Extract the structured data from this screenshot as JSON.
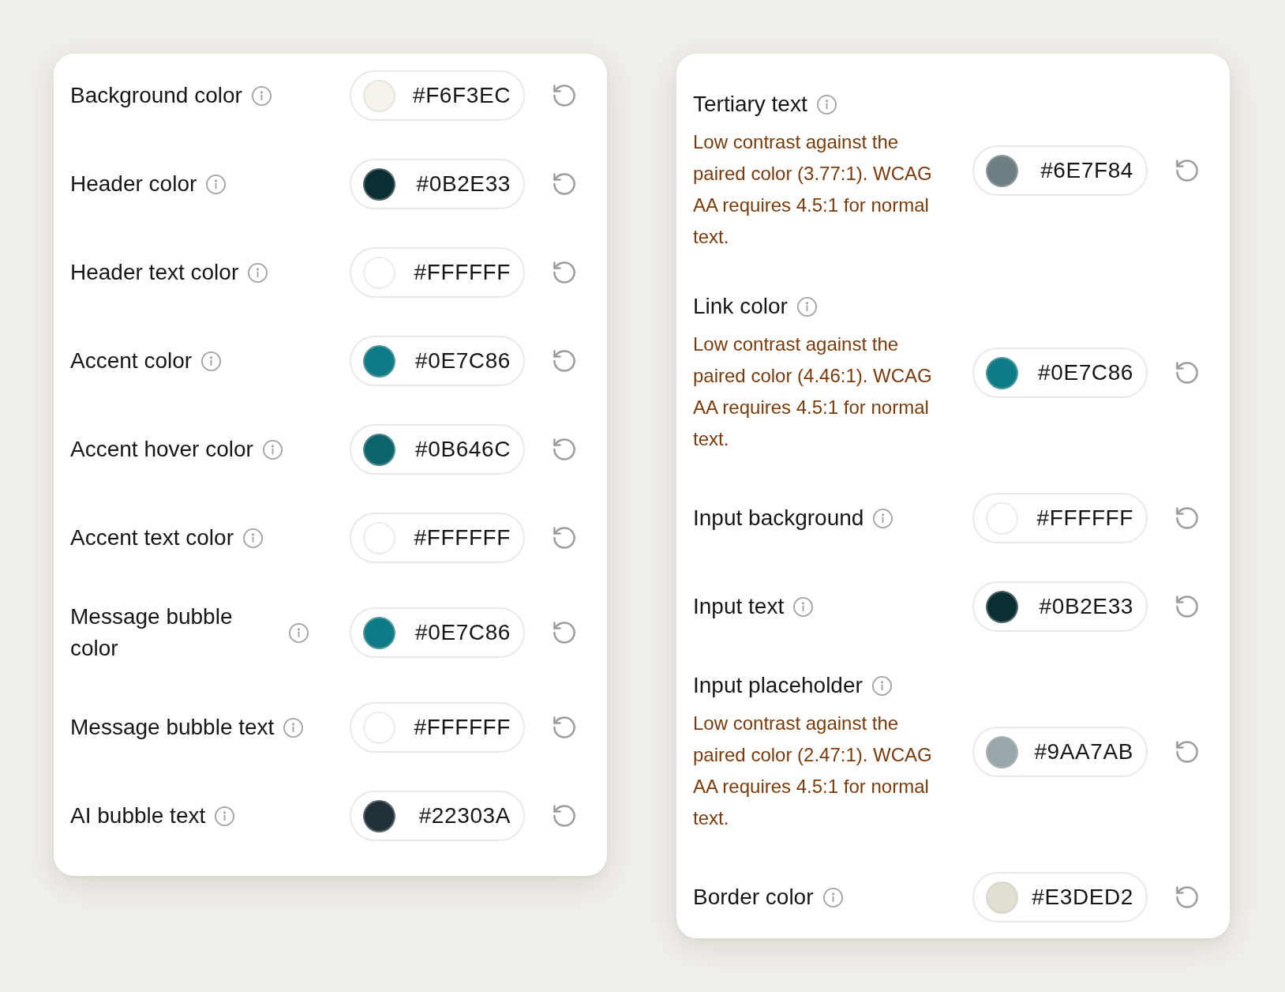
{
  "panels": [
    {
      "settings": [
        {
          "label": "Background color",
          "value": "#F6F3EC",
          "color": "#f6f3ec"
        },
        {
          "label": "Header color",
          "value": "#0B2E33",
          "color": "#0b2e33"
        },
        {
          "label": "Header text color",
          "value": "#FFFFFF",
          "color": "#ffffff"
        },
        {
          "label": "Accent color",
          "value": "#0E7C86",
          "color": "#0e7c86"
        },
        {
          "label": "Accent hover color",
          "value": "#0B646C",
          "color": "#0b646c"
        },
        {
          "label": "Accent text color",
          "value": "#FFFFFF",
          "color": "#ffffff"
        },
        {
          "label": "Message bubble color",
          "value": "#0E7C86",
          "color": "#0e7c86"
        },
        {
          "label": "Message bubble text",
          "value": "#FFFFFF",
          "color": "#ffffff"
        },
        {
          "label": "AI bubble text",
          "value": "#22303A",
          "color": "#22303a"
        }
      ]
    },
    {
      "settings": [
        {
          "label": "Tertiary text",
          "warning": "Low contrast against the paired color (3.77:1). WCAG AA requires 4.5:1 for normal text.",
          "value": "#6E7F84",
          "color": "#6e7f84"
        },
        {
          "label": "Link color",
          "warning": "Low contrast against the paired color (4.46:1). WCAG AA requires 4.5:1 for normal text.",
          "value": "#0E7C86",
          "color": "#0e7c86"
        },
        {
          "label": "Input background",
          "value": "#FFFFFF",
          "color": "#ffffff"
        },
        {
          "label": "Input text",
          "value": "#0B2E33",
          "color": "#0b2e33"
        },
        {
          "label": "Input placeholder",
          "warning": "Low contrast against the paired color (2.47:1). WCAG AA requires 4.5:1 for normal text.",
          "value": "#9AA7AB",
          "color": "#9aa7ab"
        },
        {
          "label": "Border color",
          "value": "#E3DED2",
          "color": "#e3ded2"
        }
      ]
    }
  ]
}
